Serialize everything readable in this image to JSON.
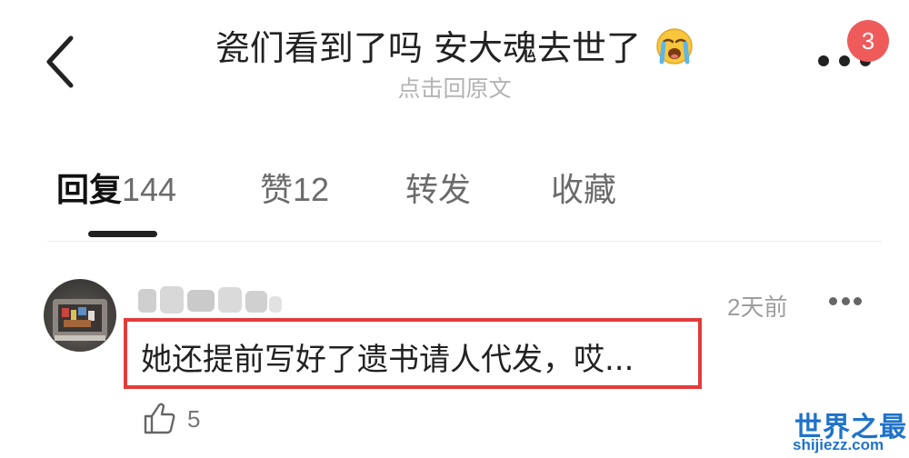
{
  "header": {
    "title": "瓷们看到了吗 安大魂去世了",
    "title_emoji": "loudly-crying-face-icon",
    "subtitle": "点击回原文",
    "notification_badge": "3"
  },
  "tabs": [
    {
      "label": "回复",
      "count": "144",
      "active": true
    },
    {
      "label": "赞",
      "count": "12",
      "active": false
    },
    {
      "label": "转发",
      "count": "",
      "active": false
    },
    {
      "label": "收藏",
      "count": "",
      "active": false
    }
  ],
  "comment": {
    "time": "2天前",
    "text": "她还提前写好了遗书请人代发，哎...",
    "likes": "5"
  },
  "watermark": {
    "main": "世界之最",
    "sub": "shijiezz.com"
  },
  "colors": {
    "accent_red": "#e23b3b",
    "badge_red": "#ef5b5b",
    "watermark_blue": "#1f73c9"
  }
}
